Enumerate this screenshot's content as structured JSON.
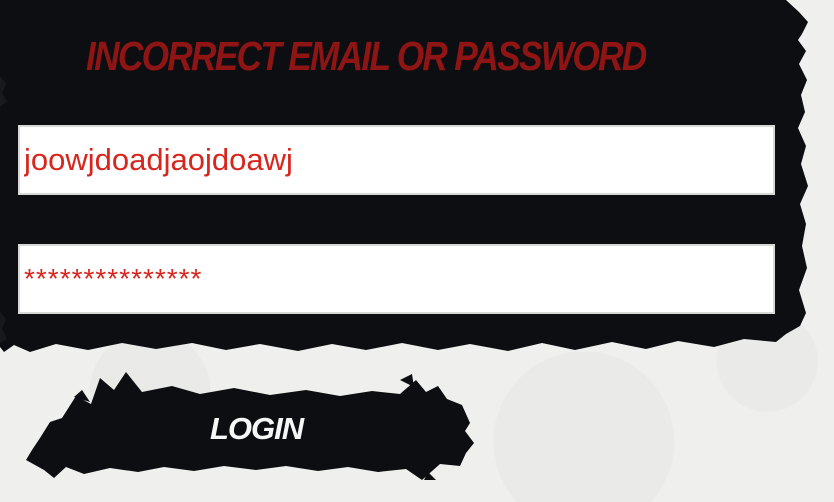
{
  "login_form": {
    "error_message": "Incorrect Email or Password",
    "email_value": "joowjdoadjaojdoawj",
    "password_value": "***************",
    "login_button_label": "LOGIN"
  },
  "colors": {
    "page_background": "#efefed",
    "panel_background": "#0d0e12",
    "error_text": "#8f1414",
    "input_text": "#d7261d",
    "button_text": "#f7f7f7"
  }
}
